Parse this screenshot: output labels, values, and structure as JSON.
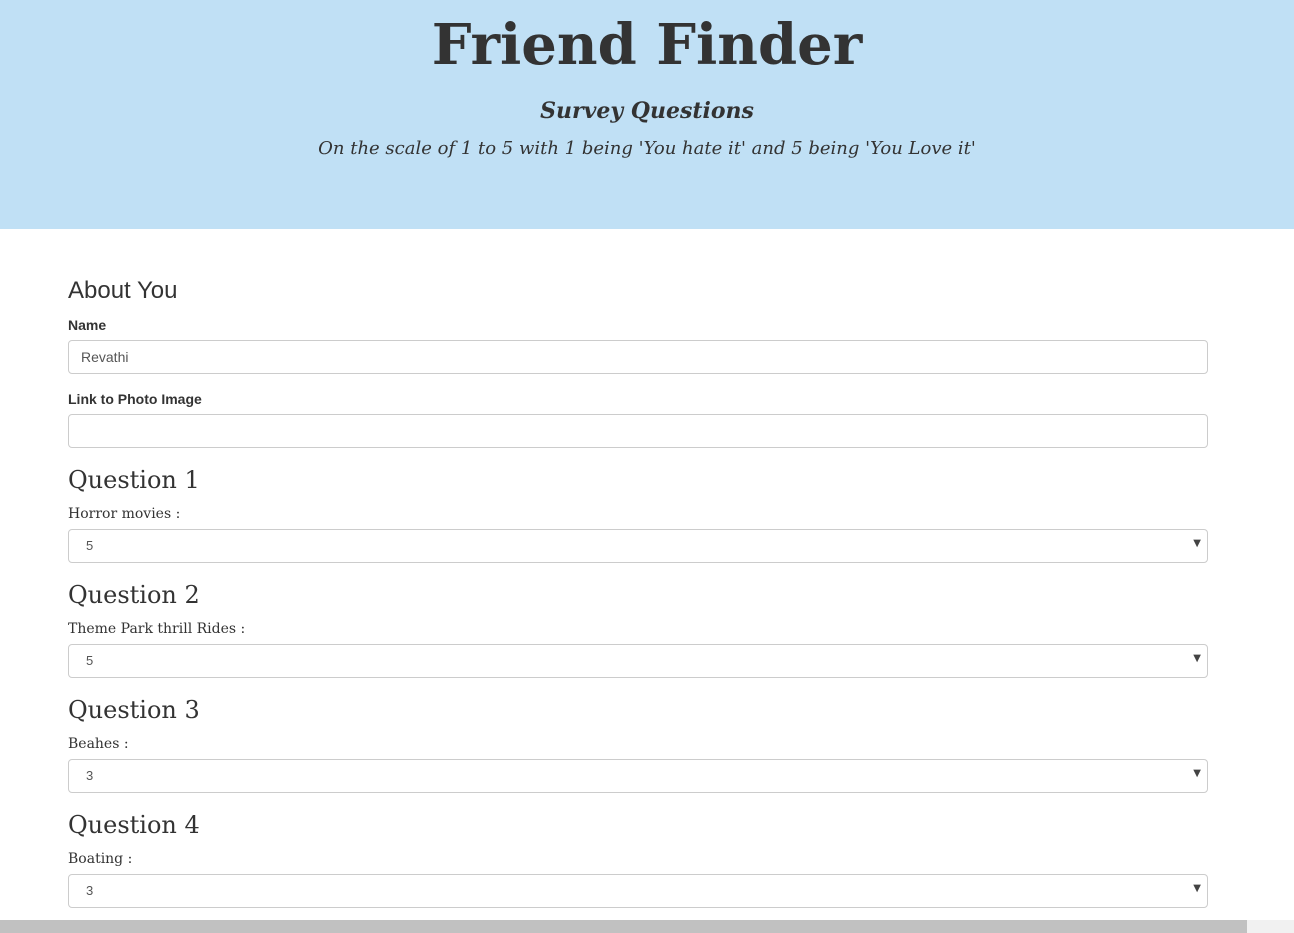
{
  "header": {
    "title": "Friend Finder",
    "subtitle": "Survey Questions",
    "description": "On the scale of 1 to 5 with 1 being 'You hate it' and 5 being 'You Love it'",
    "background_color": "#c0e0f5"
  },
  "about": {
    "title": "About You",
    "name_label": "Name",
    "name_value": "Revathi",
    "photo_label": "Link to Photo Image",
    "photo_value": ""
  },
  "questions": [
    {
      "title": "Question 1",
      "label": "Horror movies :",
      "selected": "5"
    },
    {
      "title": "Question 2",
      "label": "Theme Park thrill Rides :",
      "selected": "5"
    },
    {
      "title": "Question 3",
      "label": "Beahes :",
      "selected": "3"
    },
    {
      "title": "Question 4",
      "label": "Boating :",
      "selected": "3"
    }
  ],
  "icons": {
    "select_arrow": "chevron-down-icon"
  }
}
